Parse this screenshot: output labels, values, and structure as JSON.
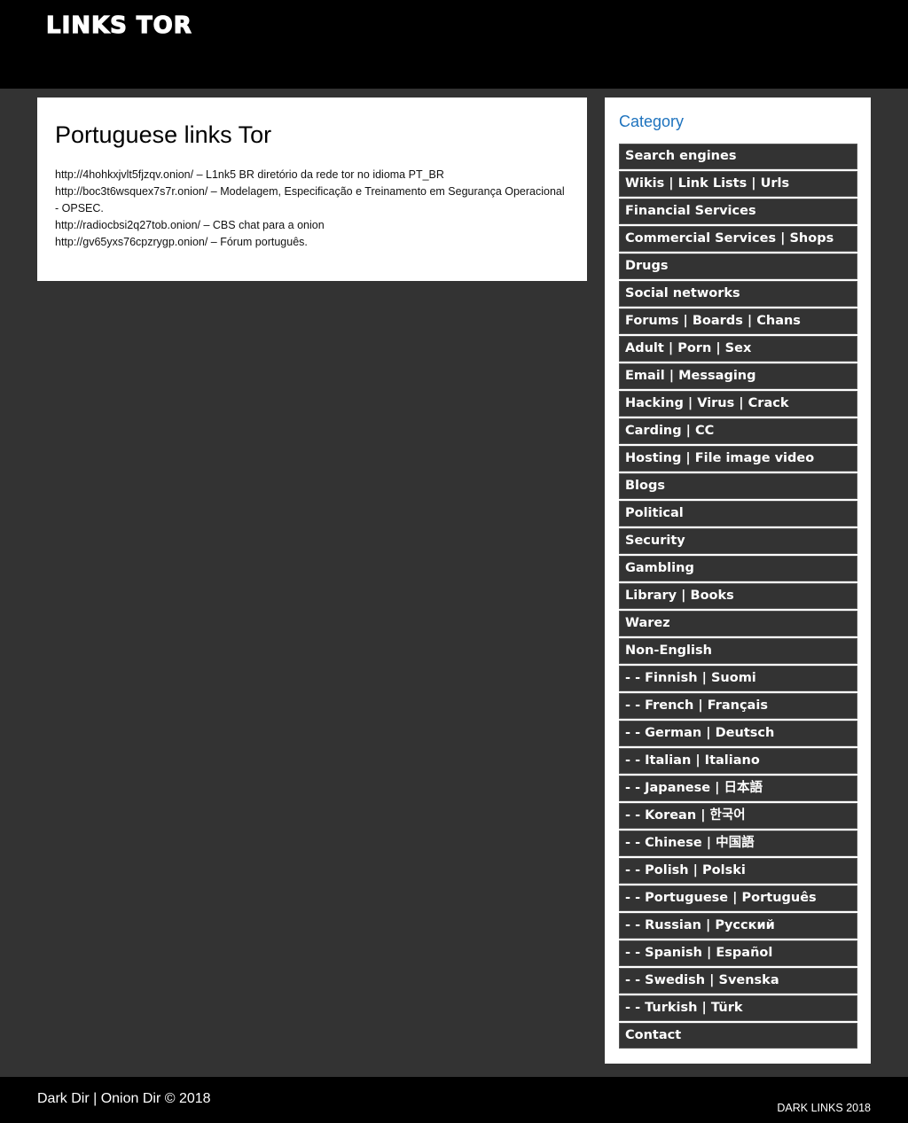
{
  "header": {
    "site_title": "LINKS TOR"
  },
  "main": {
    "title": "Portuguese links Tor",
    "lines": [
      "http://4hohkxjvlt5fjzqv.onion/ – L1nk5 BR diretório da rede tor no idioma PT_BR",
      "http://boc3t6wsquex7s7r.onion/ – Modelagem, Especificação e Treinamento em Segurança Operacional - OPSEC.",
      "http://radiocbsi2q27tob.onion/ – CBS chat para a onion",
      "http://gv65yxs76cpzrygp.onion/ – Fórum português."
    ]
  },
  "sidebar": {
    "title": "Category",
    "items": [
      "Search engines",
      "Wikis | Link Lists | Urls",
      "Financial Services",
      "Commercial Services | Shops",
      "Drugs",
      "Social networks",
      "Forums | Boards | Chans",
      "Adult | Porn | Sex",
      "Email | Messaging",
      "Hacking | Virus | Crack",
      "Carding | CC",
      "Hosting | File image video",
      "Blogs",
      "Political",
      "Security",
      "Gambling",
      "Library | Books",
      "Warez",
      "Non-English",
      "- - Finnish | Suomi",
      "- - French | Français",
      "- - German | Deutsch",
      "- - Italian | Italiano",
      "- - Japanese | 日本語",
      "- - Korean | 한국어",
      "- - Chinese | 中国語",
      "- - Polish | Polski",
      "- - Portuguese | Português",
      "- - Russian | Русский",
      "- - Spanish | Español",
      "- - Swedish | Svenska",
      "- - Turkish | Türk",
      "Contact"
    ]
  },
  "footer": {
    "left": "Dark Dir | Onion Dir © 2018",
    "right": "DARK LINKS 2018"
  },
  "colors": {
    "header_bg": "#000000",
    "page_bg": "#333333",
    "accent": "#1e73be",
    "menu_item_bg": "#333333"
  }
}
